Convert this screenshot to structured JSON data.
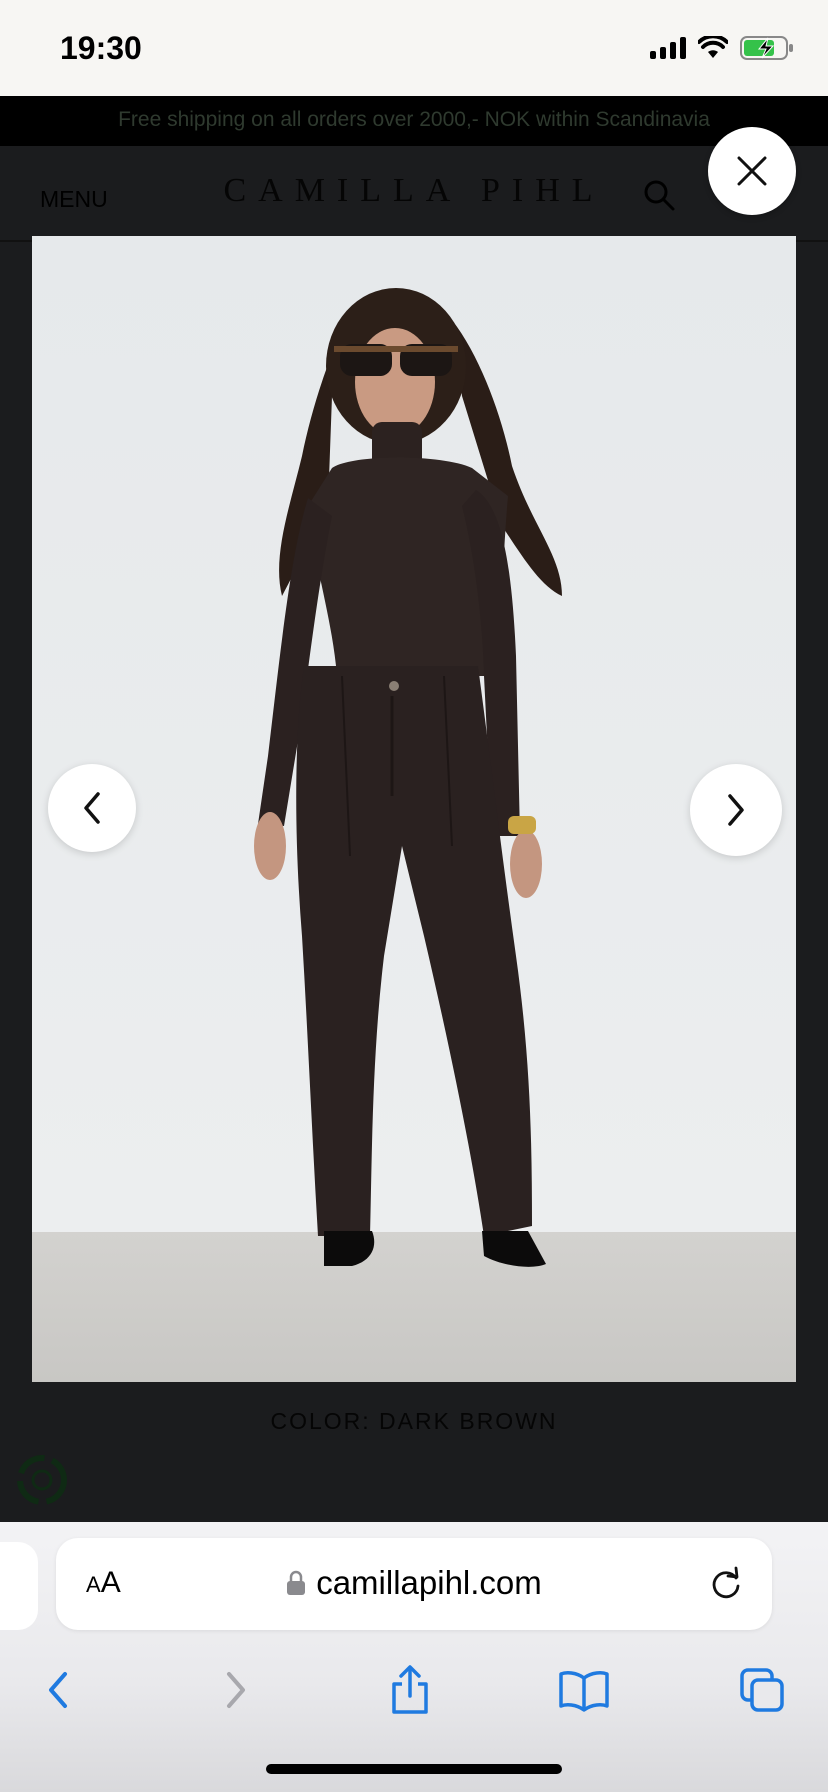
{
  "status_bar": {
    "time": "19:30",
    "icons": [
      "cellular-signal-icon",
      "wifi-icon",
      "battery-charging-icon"
    ]
  },
  "site": {
    "banner": "Free shipping on all orders over 2000,- NOK within Scandinavia",
    "menu_label": "MENU",
    "brand": "CAMILLA PIHL",
    "color_label": "COLOR: DARK BROWN"
  },
  "lightbox": {
    "image": {
      "subject": "product-photo-model-dark-brown-turtleneck-corduroy-trousers"
    },
    "icons": {
      "close": "close-icon",
      "prev": "chevron-left-icon",
      "next": "chevron-right-icon"
    }
  },
  "safari": {
    "text_size_button": {
      "small": "A",
      "large": "A"
    },
    "url": "camillapihl.com",
    "toolbar": [
      "back-icon",
      "forward-icon",
      "share-icon",
      "bookmarks-icon",
      "tabs-icon"
    ]
  },
  "colors": {
    "accent": "#1f7ae0",
    "overlay": "#1b1c1e",
    "banner_text": "#2f3a2f"
  }
}
